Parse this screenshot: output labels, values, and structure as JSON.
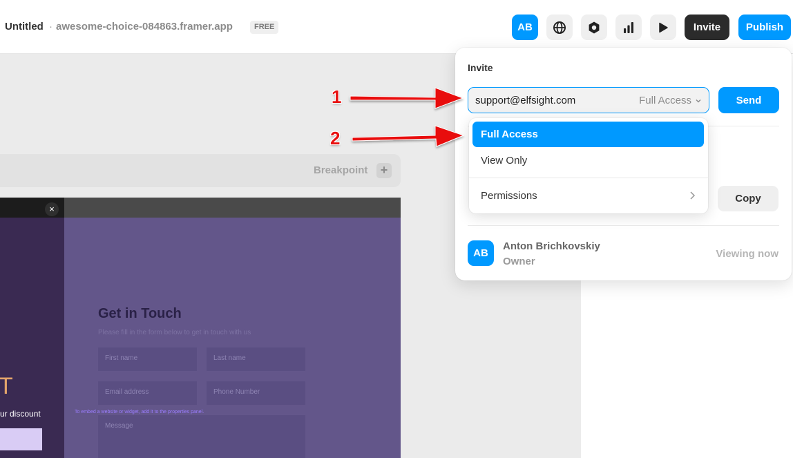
{
  "topbar": {
    "project_title": "Untitled",
    "separator": "·",
    "domain": "awesome-choice-084863.framer.app",
    "plan_badge": "FREE",
    "avatar_initials": "AB",
    "invite_label": "Invite",
    "publish_label": "Publish",
    "icons": [
      "globe-icon",
      "settings-icon",
      "analytics-icon",
      "play-icon"
    ]
  },
  "canvas": {
    "breakpoint_label": "Breakpoint",
    "breakpoint_add": "+",
    "close_glyph": "×",
    "preview": {
      "heading_fragment": "T",
      "discount_text": "ur discount",
      "form_title": "Get in Touch",
      "form_subtitle": "Please fill in the form below to get in touch with us",
      "fields": {
        "first_name": "First name",
        "last_name": "Last name",
        "email": "Email address",
        "phone": "Phone Number",
        "message": "Message"
      },
      "embed_note": "To embed a website or widget, add it to the properties panel."
    }
  },
  "invite_popover": {
    "heading": "Invite",
    "email_value": "support@elfsight.com",
    "access_value": "Full Access",
    "send_label": "Send",
    "copy_label": "Copy",
    "owner": {
      "initials": "AB",
      "name": "Anton Brichkovskiy",
      "role": "Owner",
      "status": "Viewing now"
    }
  },
  "access_dropdown": {
    "options": [
      {
        "label": "Full Access",
        "selected": true
      },
      {
        "label": "View Only",
        "selected": false
      }
    ],
    "permissions_label": "Permissions"
  },
  "annotations": {
    "step1": "1",
    "step2": "2"
  },
  "colors": {
    "accent": "#0099ff",
    "dark_button": "#2b2b2b",
    "annotation_red": "#e81010",
    "preview_purple": "#63568a"
  }
}
